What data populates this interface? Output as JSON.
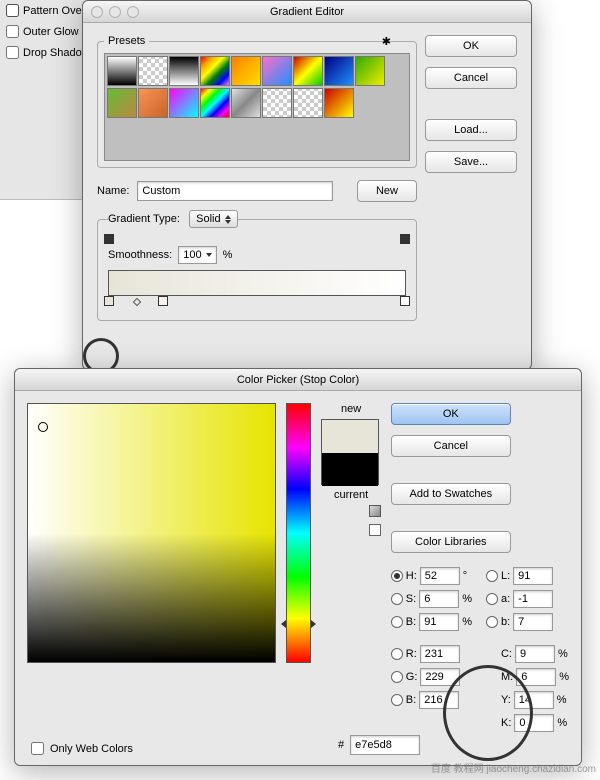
{
  "sidebar": {
    "items": [
      "Pattern Over",
      "Outer Glow",
      "Drop Shadow"
    ]
  },
  "gradient_editor": {
    "title": "Gradient Editor",
    "presets_label": "Presets",
    "ok": "OK",
    "cancel": "Cancel",
    "load": "Load...",
    "save": "Save...",
    "name_label": "Name:",
    "name_value": "Custom",
    "new_btn": "New",
    "type_label": "Gradient Type:",
    "type_value": "Solid",
    "smooth_label": "Smoothness:",
    "smooth_value": "100",
    "pct": "%"
  },
  "color_picker": {
    "title": "Color Picker (Stop Color)",
    "new_label": "new",
    "current_label": "current",
    "ok": "OK",
    "cancel": "Cancel",
    "add_swatches": "Add to Swatches",
    "libraries": "Color Libraries",
    "only_web": "Only Web Colors",
    "hash": "#",
    "hex": "e7e5d8",
    "deg": "°",
    "pct": "%",
    "hsv": {
      "H_label": "H:",
      "H": "52",
      "S_label": "S:",
      "S": "6",
      "B_label": "B:",
      "B": "91"
    },
    "rgb": {
      "R_label": "R:",
      "R": "231",
      "G_label": "G:",
      "G": "229",
      "B_label": "B:",
      "B": "216"
    },
    "lab": {
      "L_label": "L:",
      "L": "91",
      "a_label": "a:",
      "a": "-1",
      "b_label": "b:",
      "b": "7"
    },
    "cmyk": {
      "C_label": "C:",
      "C": "9",
      "M_label": "M:",
      "M": "6",
      "Y_label": "Y:",
      "Y": "14",
      "K_label": "K:",
      "K": "0"
    }
  },
  "watermark": "百度 教程网\njiaocheng.chazidian.com"
}
